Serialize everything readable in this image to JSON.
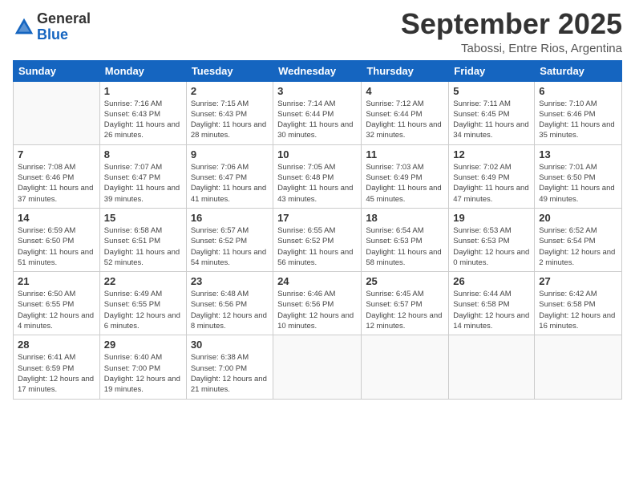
{
  "header": {
    "logo_general": "General",
    "logo_blue": "Blue",
    "main_title": "September 2025",
    "subtitle": "Tabossi, Entre Rios, Argentina"
  },
  "weekdays": [
    "Sunday",
    "Monday",
    "Tuesday",
    "Wednesday",
    "Thursday",
    "Friday",
    "Saturday"
  ],
  "weeks": [
    [
      {
        "day": "",
        "info": ""
      },
      {
        "day": "1",
        "info": "Sunrise: 7:16 AM\nSunset: 6:43 PM\nDaylight: 11 hours\nand 26 minutes."
      },
      {
        "day": "2",
        "info": "Sunrise: 7:15 AM\nSunset: 6:43 PM\nDaylight: 11 hours\nand 28 minutes."
      },
      {
        "day": "3",
        "info": "Sunrise: 7:14 AM\nSunset: 6:44 PM\nDaylight: 11 hours\nand 30 minutes."
      },
      {
        "day": "4",
        "info": "Sunrise: 7:12 AM\nSunset: 6:44 PM\nDaylight: 11 hours\nand 32 minutes."
      },
      {
        "day": "5",
        "info": "Sunrise: 7:11 AM\nSunset: 6:45 PM\nDaylight: 11 hours\nand 34 minutes."
      },
      {
        "day": "6",
        "info": "Sunrise: 7:10 AM\nSunset: 6:46 PM\nDaylight: 11 hours\nand 35 minutes."
      }
    ],
    [
      {
        "day": "7",
        "info": "Sunrise: 7:08 AM\nSunset: 6:46 PM\nDaylight: 11 hours\nand 37 minutes."
      },
      {
        "day": "8",
        "info": "Sunrise: 7:07 AM\nSunset: 6:47 PM\nDaylight: 11 hours\nand 39 minutes."
      },
      {
        "day": "9",
        "info": "Sunrise: 7:06 AM\nSunset: 6:47 PM\nDaylight: 11 hours\nand 41 minutes."
      },
      {
        "day": "10",
        "info": "Sunrise: 7:05 AM\nSunset: 6:48 PM\nDaylight: 11 hours\nand 43 minutes."
      },
      {
        "day": "11",
        "info": "Sunrise: 7:03 AM\nSunset: 6:49 PM\nDaylight: 11 hours\nand 45 minutes."
      },
      {
        "day": "12",
        "info": "Sunrise: 7:02 AM\nSunset: 6:49 PM\nDaylight: 11 hours\nand 47 minutes."
      },
      {
        "day": "13",
        "info": "Sunrise: 7:01 AM\nSunset: 6:50 PM\nDaylight: 11 hours\nand 49 minutes."
      }
    ],
    [
      {
        "day": "14",
        "info": "Sunrise: 6:59 AM\nSunset: 6:50 PM\nDaylight: 11 hours\nand 51 minutes."
      },
      {
        "day": "15",
        "info": "Sunrise: 6:58 AM\nSunset: 6:51 PM\nDaylight: 11 hours\nand 52 minutes."
      },
      {
        "day": "16",
        "info": "Sunrise: 6:57 AM\nSunset: 6:52 PM\nDaylight: 11 hours\nand 54 minutes."
      },
      {
        "day": "17",
        "info": "Sunrise: 6:55 AM\nSunset: 6:52 PM\nDaylight: 11 hours\nand 56 minutes."
      },
      {
        "day": "18",
        "info": "Sunrise: 6:54 AM\nSunset: 6:53 PM\nDaylight: 11 hours\nand 58 minutes."
      },
      {
        "day": "19",
        "info": "Sunrise: 6:53 AM\nSunset: 6:53 PM\nDaylight: 12 hours\nand 0 minutes."
      },
      {
        "day": "20",
        "info": "Sunrise: 6:52 AM\nSunset: 6:54 PM\nDaylight: 12 hours\nand 2 minutes."
      }
    ],
    [
      {
        "day": "21",
        "info": "Sunrise: 6:50 AM\nSunset: 6:55 PM\nDaylight: 12 hours\nand 4 minutes."
      },
      {
        "day": "22",
        "info": "Sunrise: 6:49 AM\nSunset: 6:55 PM\nDaylight: 12 hours\nand 6 minutes."
      },
      {
        "day": "23",
        "info": "Sunrise: 6:48 AM\nSunset: 6:56 PM\nDaylight: 12 hours\nand 8 minutes."
      },
      {
        "day": "24",
        "info": "Sunrise: 6:46 AM\nSunset: 6:56 PM\nDaylight: 12 hours\nand 10 minutes."
      },
      {
        "day": "25",
        "info": "Sunrise: 6:45 AM\nSunset: 6:57 PM\nDaylight: 12 hours\nand 12 minutes."
      },
      {
        "day": "26",
        "info": "Sunrise: 6:44 AM\nSunset: 6:58 PM\nDaylight: 12 hours\nand 14 minutes."
      },
      {
        "day": "27",
        "info": "Sunrise: 6:42 AM\nSunset: 6:58 PM\nDaylight: 12 hours\nand 16 minutes."
      }
    ],
    [
      {
        "day": "28",
        "info": "Sunrise: 6:41 AM\nSunset: 6:59 PM\nDaylight: 12 hours\nand 17 minutes."
      },
      {
        "day": "29",
        "info": "Sunrise: 6:40 AM\nSunset: 7:00 PM\nDaylight: 12 hours\nand 19 minutes."
      },
      {
        "day": "30",
        "info": "Sunrise: 6:38 AM\nSunset: 7:00 PM\nDaylight: 12 hours\nand 21 minutes."
      },
      {
        "day": "",
        "info": ""
      },
      {
        "day": "",
        "info": ""
      },
      {
        "day": "",
        "info": ""
      },
      {
        "day": "",
        "info": ""
      }
    ]
  ]
}
